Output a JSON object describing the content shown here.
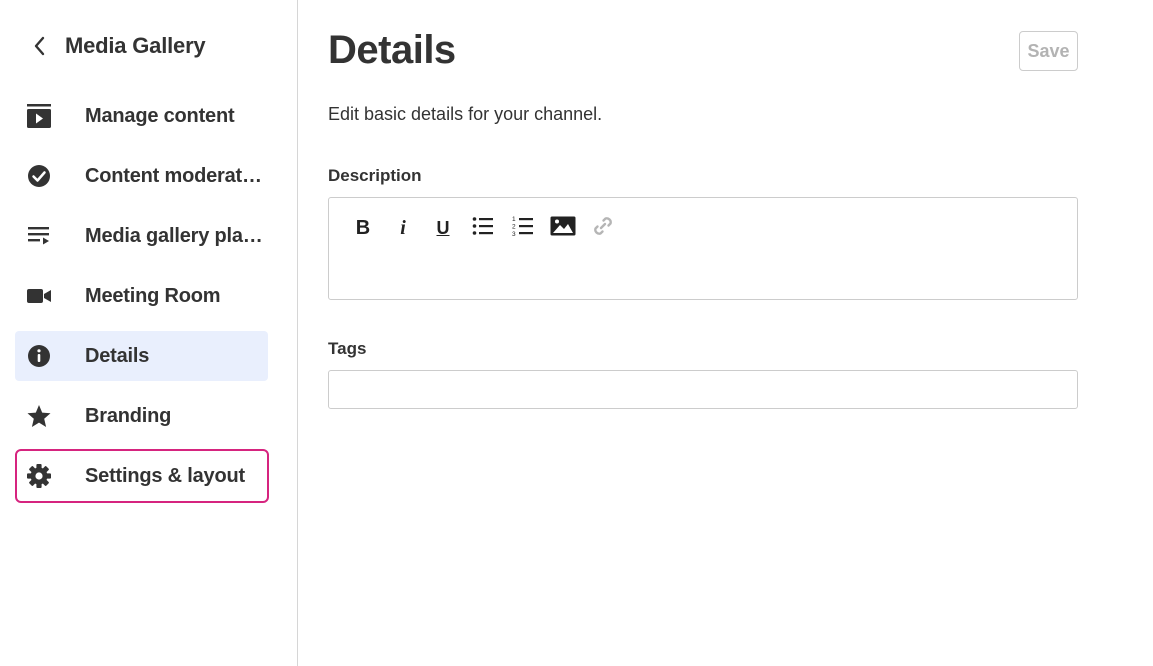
{
  "sidebar": {
    "back_label": "Media Gallery",
    "items": [
      {
        "label": "Manage content",
        "icon": "play-box-icon"
      },
      {
        "label": "Content moderation",
        "icon": "check-circle-icon"
      },
      {
        "label": "Media gallery playlists",
        "icon": "playlist-icon"
      },
      {
        "label": "Meeting Room",
        "icon": "video-camera-icon"
      },
      {
        "label": "Details",
        "icon": "info-icon",
        "active": true
      },
      {
        "label": "Branding",
        "icon": "star-icon"
      },
      {
        "label": "Settings & layout",
        "icon": "gear-icon",
        "highlighted": true
      }
    ]
  },
  "main": {
    "title": "Details",
    "save_label": "Save",
    "subtitle": "Edit basic details for your channel.",
    "description_label": "Description",
    "toolbar": {
      "bold": "B",
      "italic": "i",
      "underline": "U",
      "buttons": [
        "bold-icon",
        "italic-icon",
        "underline-icon",
        "bullet-list-icon",
        "numbered-list-icon",
        "image-icon",
        "link-icon"
      ]
    },
    "description_value": "",
    "tags_label": "Tags",
    "tags_value": ""
  },
  "colors": {
    "active_bg": "#e9effd",
    "highlight_border": "#d6247f",
    "text": "#333333",
    "border": "#cccccc"
  }
}
